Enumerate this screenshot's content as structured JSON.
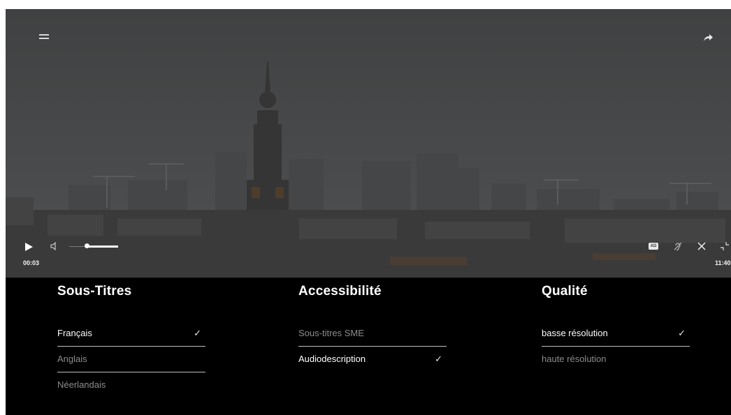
{
  "player": {
    "time_current": "00:03",
    "time_total": "11:40",
    "volume_level": 0.35,
    "audio_description_badge": "AD",
    "icons": {
      "menu": "menu-icon",
      "share": "share-icon",
      "play": "play-icon",
      "volume": "volume-icon",
      "audio_description": "audio-description-icon",
      "hearing": "hearing-impaired-icon",
      "close": "close-icon",
      "fullscreen": "exit-fullscreen-icon"
    }
  },
  "panels": {
    "subtitles": {
      "title": "Sous-Titres",
      "options": [
        {
          "label": "Français",
          "selected": true
        },
        {
          "label": "Anglais",
          "selected": false
        },
        {
          "label": "Néerlandais",
          "selected": false
        }
      ]
    },
    "accessibility": {
      "title": "Accessibilité",
      "options": [
        {
          "label": "Sous-titres SME",
          "selected": false
        },
        {
          "label": "Audiodescription",
          "selected": true
        }
      ]
    },
    "quality": {
      "title": "Qualité",
      "options": [
        {
          "label": "basse résolution",
          "selected": true
        },
        {
          "label": "haute résolution",
          "selected": false
        }
      ]
    }
  },
  "check_glyph": "✓",
  "colors": {
    "overlay": "#4a4b4c",
    "panel_bg": "#000000",
    "selected_text": "#ffffff",
    "unselected_text": "#8c8c8c"
  }
}
